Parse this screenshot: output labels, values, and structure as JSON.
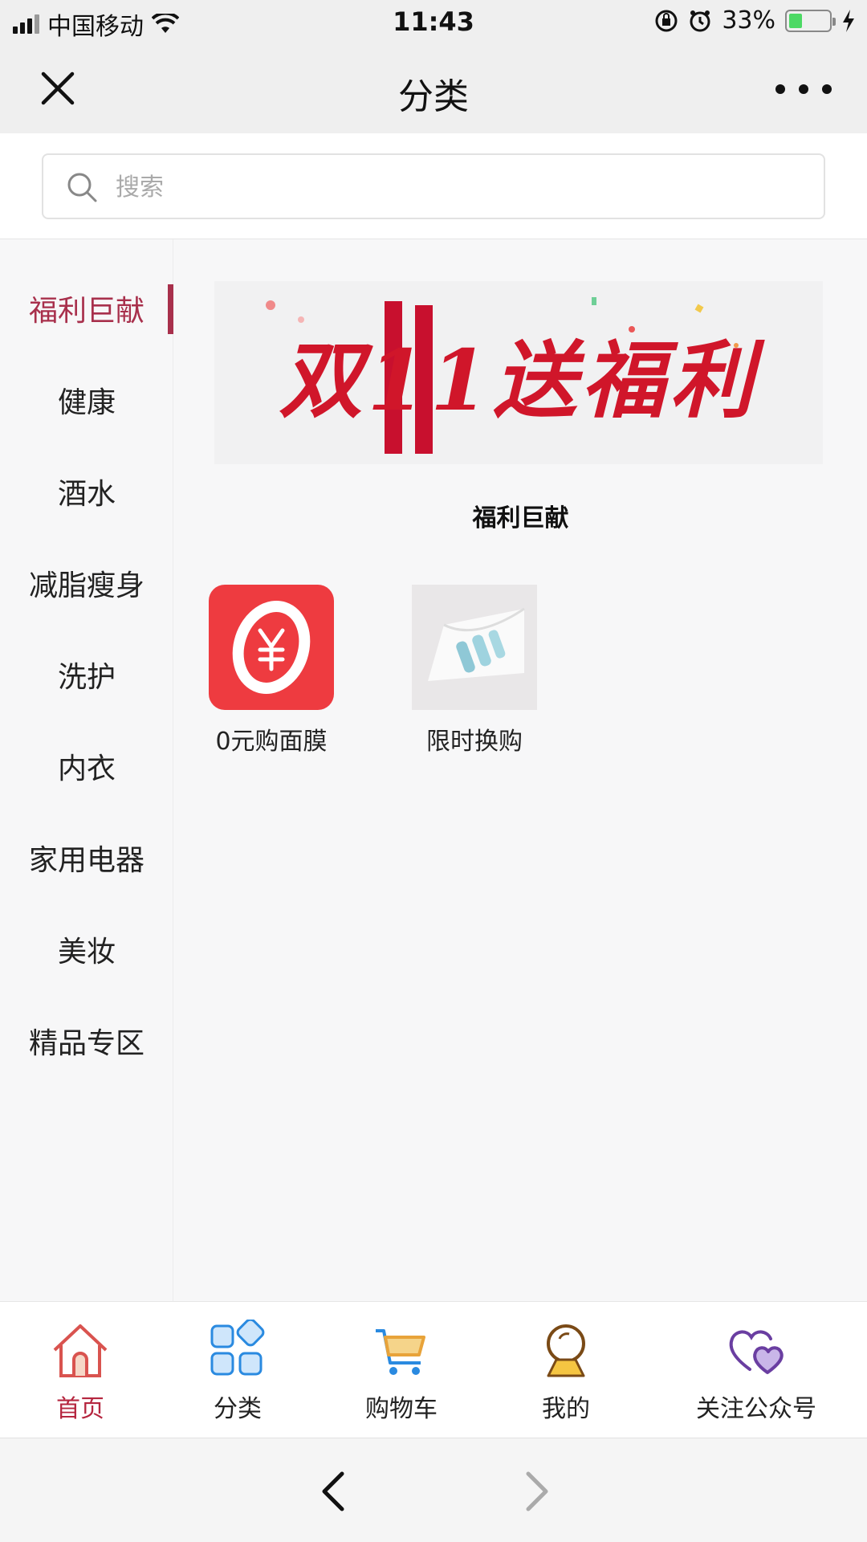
{
  "status_bar": {
    "carrier": "中国移动",
    "time": "11:43",
    "battery": "33%"
  },
  "navbar": {
    "title": "分类"
  },
  "search": {
    "placeholder": "搜索"
  },
  "sidebar": {
    "items": [
      {
        "label": "福利巨献",
        "active": true
      },
      {
        "label": "健康"
      },
      {
        "label": "酒水"
      },
      {
        "label": "减脂瘦身"
      },
      {
        "label": "洗护"
      },
      {
        "label": "内衣"
      },
      {
        "label": "家用电器"
      },
      {
        "label": "美妆"
      },
      {
        "label": "精品专区"
      }
    ]
  },
  "content": {
    "banner_text": "双11送福利",
    "section_title": "福利巨献",
    "tiles": [
      {
        "label": "0元购面膜",
        "icon": "yen-coin-icon"
      },
      {
        "label": "限时换购",
        "icon": "product-photo"
      }
    ]
  },
  "tabbar": {
    "items": [
      {
        "label": "首页",
        "icon": "home-icon",
        "active": true
      },
      {
        "label": "分类",
        "icon": "category-grid-icon"
      },
      {
        "label": "购物车",
        "icon": "cart-icon"
      },
      {
        "label": "我的",
        "icon": "profile-icon"
      },
      {
        "label": "关注公众号",
        "icon": "hearts-icon"
      }
    ]
  },
  "colors": {
    "accent": "#a8304c",
    "tab_active": "#b5263f",
    "banner_red": "#d0162a"
  }
}
